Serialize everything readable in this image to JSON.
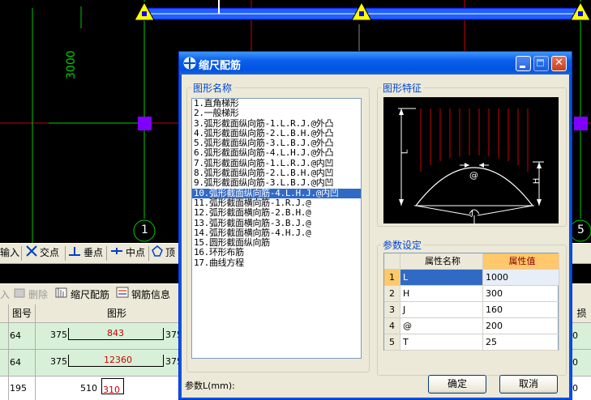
{
  "canvas": {
    "dimension_label": "3000",
    "axis_labels": [
      "1",
      "5"
    ]
  },
  "toolbar1": {
    "items": [
      {
        "label": "输入",
        "icon": "input-icon"
      },
      {
        "label": "交点",
        "icon": "intersection-snap-icon"
      },
      {
        "label": "垂点",
        "icon": "perpendicular-snap-icon"
      },
      {
        "label": "中点",
        "icon": "midpoint-snap-icon"
      },
      {
        "label": "顶",
        "icon": "vertex-snap-icon"
      }
    ]
  },
  "toolbar2": {
    "items": [
      {
        "label": "入",
        "icon": ""
      },
      {
        "label": "删除",
        "icon": "delete-icon"
      },
      {
        "label": "缩尺配筋",
        "icon": "scale-rebar-icon"
      },
      {
        "label": "钢筋信息",
        "icon": "rebar-info-icon"
      }
    ]
  },
  "grid": {
    "columns": [
      "图号",
      "图形",
      "损耗"
    ],
    "rows": [
      {
        "col0": "64",
        "fig_no": "64",
        "left": "375",
        "mid": "843",
        "right": "375",
        "r": "0"
      },
      {
        "col0": "64",
        "fig_no": "64",
        "left": "375",
        "mid": "12360",
        "right": "375",
        "r": "0"
      },
      {
        "col0": "195",
        "fig_no": "195",
        "left": "510",
        "mid": "310",
        "right": "",
        "r": "0"
      }
    ]
  },
  "dialog": {
    "title": "缩尺配筋",
    "shape_group": "图形名称",
    "feature_group": "图形特征",
    "param_group": "参数设定",
    "shapes": [
      "1.直角梯形",
      "2.一般梯形",
      "3.弧形截面纵向筋-1.L.R.J.@外凸",
      "4.弧形截面纵向筋-2.L.B.H.@外凸",
      "5.弧形截面纵向筋-3.L.B.J.@外凸",
      "6.弧形截面纵向筋-4.L.H.J.@外凸",
      "7.弧形截面纵向筋-1.L.R.J.@内凹",
      "8.弧形截面纵向筋-2.L.B.H.@内凹",
      "9.弧形截面纵向筋-3.L.B.J.@内凹",
      "10.弧形截面纵向筋-4.L.H.J.@内凹",
      "11.弧形截面横向筋-1.R.J.@",
      "12.弧形截面横向筋-2.B.H.@",
      "13.弧形截面横向筋-3.B.J.@",
      "14.弧形截面横向筋-4.H.J.@",
      "15.圆形截面纵向筋",
      "16.环形布筋",
      "17.曲线方程"
    ],
    "selected_index": 9,
    "figure_labels": {
      "L": "L",
      "H": "H",
      "at": "@",
      "J": "J"
    },
    "param_table": {
      "headers": [
        "属性名称",
        "属性值"
      ],
      "rows": [
        {
          "no": "1",
          "name": "L",
          "value": "1000"
        },
        {
          "no": "2",
          "name": "H",
          "value": "300"
        },
        {
          "no": "3",
          "name": "J",
          "value": "160"
        },
        {
          "no": "4",
          "name": "@",
          "value": "200"
        },
        {
          "no": "5",
          "name": "T",
          "value": "25"
        }
      ]
    },
    "param_label": "参数L(mm):",
    "ok_label": "确定",
    "cancel_label": "取消"
  }
}
